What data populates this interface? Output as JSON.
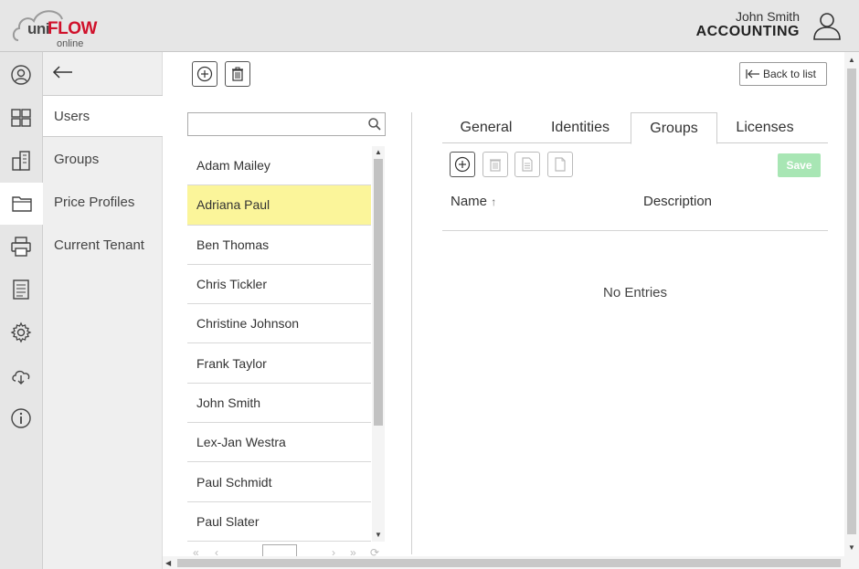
{
  "header": {
    "logo": {
      "uni": "uni",
      "flow": "FLOW",
      "online": "online"
    },
    "user_name": "John Smith",
    "tenant": "ACCOUNTING"
  },
  "rail": {
    "icons": [
      "user-circle-icon",
      "grid-icon",
      "building-icon",
      "folder-icon",
      "printer-icon",
      "document-list-icon",
      "gear-icon",
      "cloud-download-icon",
      "info-icon"
    ],
    "active_index": 3
  },
  "subnav": {
    "items": [
      {
        "label": "Users"
      },
      {
        "label": "Groups"
      },
      {
        "label": "Price Profiles"
      },
      {
        "label": "Current Tenant"
      }
    ]
  },
  "toolbar": {
    "back_to_list": "Back to list"
  },
  "search": {
    "value": "",
    "placeholder": ""
  },
  "users": [
    {
      "name": "Adam Mailey"
    },
    {
      "name": "Adriana Paul",
      "selected": true
    },
    {
      "name": "Ben Thomas"
    },
    {
      "name": "Chris Tickler"
    },
    {
      "name": "Christine Johnson"
    },
    {
      "name": "Frank Taylor"
    },
    {
      "name": "John Smith"
    },
    {
      "name": "Lex-Jan Westra"
    },
    {
      "name": "Paul Schmidt"
    },
    {
      "name": "Paul Slater"
    }
  ],
  "tabs": [
    {
      "label": "General"
    },
    {
      "label": "Identities"
    },
    {
      "label": "Groups",
      "active": true
    },
    {
      "label": "Licenses"
    }
  ],
  "detail": {
    "save_label": "Save",
    "columns": {
      "name": "Name",
      "sort_indicator": "↑",
      "description": "Description"
    },
    "empty_text": "No Entries"
  },
  "colors": {
    "selected_row": "#fbf59a",
    "save_button": "#a8e6b4",
    "brand_red": "#d0112b"
  }
}
